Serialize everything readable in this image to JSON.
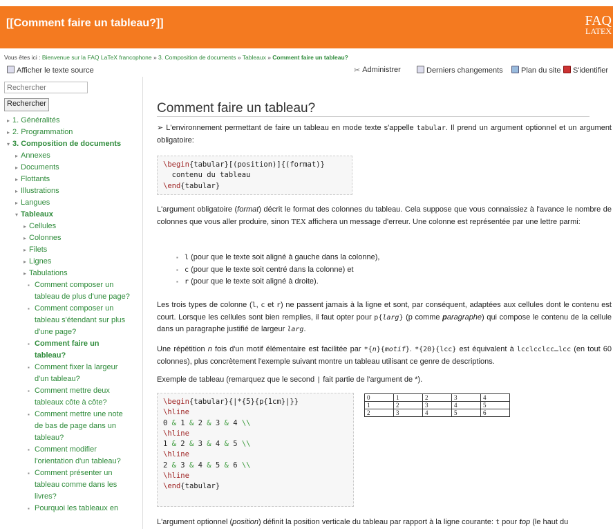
{
  "header": {
    "title": "[[Comment faire un tableau?]]",
    "logo_line1": "FAQ",
    "logo_line2": "LATEX"
  },
  "breadcrumb": {
    "prefix": "Vous êtes ici : ",
    "items": [
      "Bienvenue sur la FAQ LaTeX francophone",
      "3. Composition de documents",
      "Tableaux"
    ],
    "separator": " » ",
    "current": "Comment faire un tableau?"
  },
  "toolbar": {
    "source_label": "Afficher le texte source",
    "admin_label": "Administrer",
    "changes_label": "Derniers changements",
    "sitemap_label": "Plan du site",
    "login_label": "S'identifier"
  },
  "sidebar": {
    "search_placeholder": "Rechercher",
    "search_button": "Rechercher",
    "nav": [
      "1. Généralités",
      "2. Programmation",
      "3. Composition de documents",
      "Annexes",
      "Documents",
      "Flottants",
      "Illustrations",
      "Langues",
      "Tableaux",
      "Cellules",
      "Colonnes",
      "Filets",
      "Lignes",
      "Tabulations",
      "Comment composer un tableau de plus d'une page?",
      "Comment composer un tableau s'étendant sur plus d'une page?",
      "Comment faire un tableau?",
      "Comment fixer la largeur d'un tableau?",
      "Comment mettre deux tableaux côte à côte?",
      "Comment mettre une note de bas de page dans un tableau?",
      "Comment modifier l'orientation d'un tableau?",
      "Comment présenter un tableau comme dans les livres?",
      "Pourquoi les tableaux en"
    ]
  },
  "main": {
    "title": "Comment faire un tableau?",
    "p1": [
      "➢ L'environnement permettant de faire un tableau en mode texte s'appelle ",
      "tabular",
      ". Il prend un argument optionnel et un argument obligatoire:"
    ],
    "code1": [
      "\\begin",
      "{tabular}[(position)]{(format)}",
      "  contenu du tableau",
      "\\end",
      "{tabular}"
    ],
    "p2": [
      "L'argument obligatoire (",
      "format",
      ") décrit le format des colonnes du tableau. Cela suppose que vous connaissiez à l'avance le nombre de colonnes que vous aller produire, sinon ",
      "TEX",
      " affichera un message d'erreur. Une colonne est représentée par une lettre parmi:"
    ],
    "list": [
      [
        "l",
        " (pour que le texte soit aligné à gauche dans la colonne),"
      ],
      [
        "c",
        " (pour que le texte soit centré dans la colonne) et"
      ],
      [
        "r",
        " (pour que le texte soit aligné à droite)."
      ]
    ],
    "p3": [
      "Les trois types de colonne (",
      "l",
      ", ",
      "c",
      " et ",
      "r",
      ") ne passent jamais à la ligne et sont, par conséquent, adaptées aux cellules dont le contenu est court. Lorsque les cellules sont bien remplies, il faut opter pour ",
      "p{",
      "larg",
      "}",
      " (p comme ",
      "p",
      "aragraphe",
      ") qui compose le contenu de la cellule dans un paragraphe justifié de largeur ",
      "larg",
      "."
    ],
    "p4": [
      "Une répétition ",
      "n",
      " fois d'un motif élémentaire est facilitée par ",
      "*{",
      "n",
      "}{",
      "motif",
      "}",
      ". ",
      "*{20}{lcc}",
      " est équivalent à ",
      "lcclcclcc…lcc",
      " (en tout 60 colonnes), plus concrètement l'exemple suivant montre un tableau utilisant ce genre de descriptions."
    ],
    "p5": [
      "Exemple de tableau (remarquez que le second ",
      "|",
      " fait partie de l'argument de *)."
    ],
    "code2": [
      "\\begin",
      "{tabular}{|*{5}{p{1cm}|}}",
      "\\hline",
      "0 & 1 & 2 & 3 & 4 \\\\",
      "1 & 2 & 3 & 4 & 5 \\\\",
      "2 & 3 & 4 & 5 & 6 \\\\",
      "\\end",
      "{tabular}",
      "&",
      "\\\\"
    ],
    "table_rows": [
      [
        "0",
        "1",
        "2",
        "3",
        "4"
      ],
      [
        "1",
        "2",
        "3",
        "4",
        "5"
      ],
      [
        "2",
        "3",
        "4",
        "5",
        "6"
      ]
    ],
    "p6": [
      "L'argument optionnel (",
      "position",
      ") définit la position verticale du tableau par rapport à la ligne courante: ",
      "t",
      " pour ",
      "t",
      "op",
      " (le haut du"
    ]
  }
}
